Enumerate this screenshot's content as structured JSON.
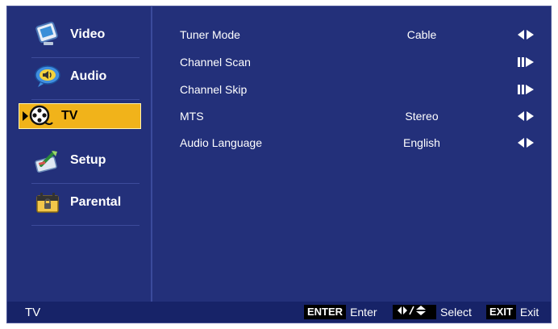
{
  "sidebar": {
    "items": [
      {
        "label": "Video",
        "icon": "video-monitor-icon"
      },
      {
        "label": "Audio",
        "icon": "speaker-bubble-icon"
      },
      {
        "label": "TV",
        "icon": "film-reel-icon",
        "active": true
      },
      {
        "label": "Setup",
        "icon": "setup-tools-icon"
      },
      {
        "label": "Parental",
        "icon": "parental-lock-icon"
      }
    ]
  },
  "menu": {
    "rows": [
      {
        "label": "Tuner Mode",
        "value": "Cable",
        "arrow": "left-right-arrow-icon"
      },
      {
        "label": "Channel Scan",
        "value": "",
        "arrow": "enter-right-arrow-icon"
      },
      {
        "label": "Channel Skip",
        "value": "",
        "arrow": "enter-right-arrow-icon"
      },
      {
        "label": "MTS",
        "value": "Stereo",
        "arrow": "left-right-arrow-icon"
      },
      {
        "label": "Audio Language",
        "value": "English",
        "arrow": "left-right-arrow-icon"
      }
    ]
  },
  "footer": {
    "title": "TV",
    "enter_key": "ENTER",
    "enter_label": "Enter",
    "select_label": "Select",
    "exit_key": "EXIT",
    "exit_label": "Exit"
  },
  "colors": {
    "background": "#23307a",
    "footer": "#172368",
    "highlight": "#f1b31a"
  }
}
